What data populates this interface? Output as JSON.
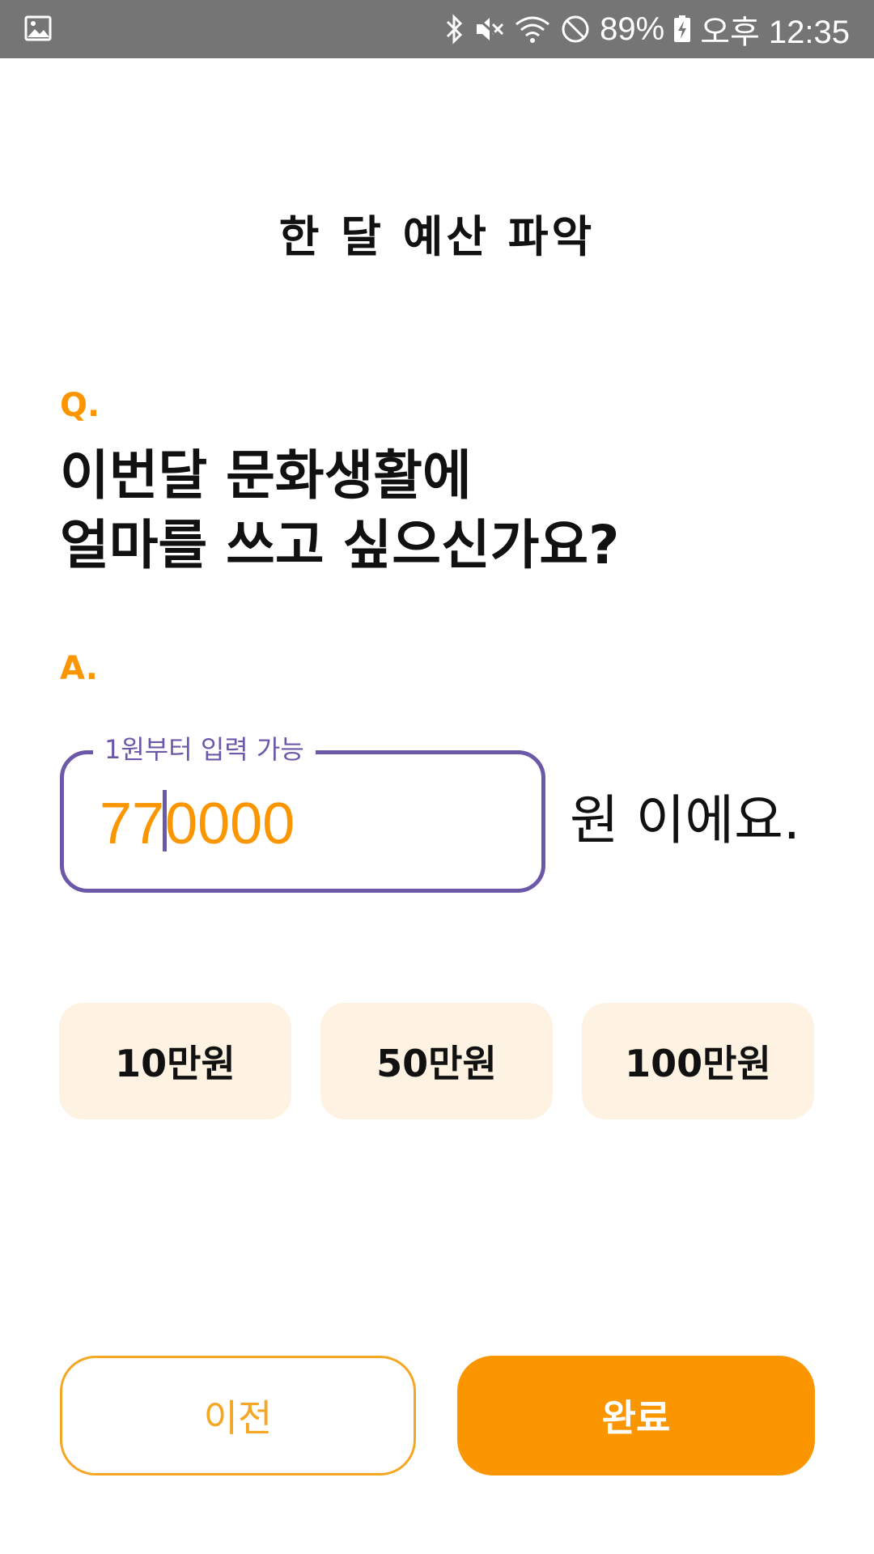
{
  "status_bar": {
    "battery": "89%",
    "time": "오후 12:35",
    "icons": [
      "gallery-icon",
      "bluetooth-icon",
      "mute-icon",
      "wifi-icon",
      "no-sim-icon",
      "battery-charging-icon"
    ]
  },
  "header": {
    "title": "한 달 예산 파악"
  },
  "question": {
    "label": "Q.",
    "line1": "이번달 문화생활에",
    "line2": "얼마를 쓰고 싶으신가요?"
  },
  "answer": {
    "label": "A.",
    "field_label": "1원부터 입력 가능",
    "value_before_cursor": "77",
    "value_after_cursor": "0000",
    "unit_suffix": "원 이에요."
  },
  "quick_amounts": [
    {
      "label": "10만원"
    },
    {
      "label": "50만원"
    },
    {
      "label": "100만원"
    }
  ],
  "footer": {
    "prev_label": "이전",
    "done_label": "완료"
  },
  "colors": {
    "accent": "#FB9500",
    "field_border": "#6B58A8",
    "chip_bg": "#FEF2E2",
    "status_bar": "#757575"
  }
}
